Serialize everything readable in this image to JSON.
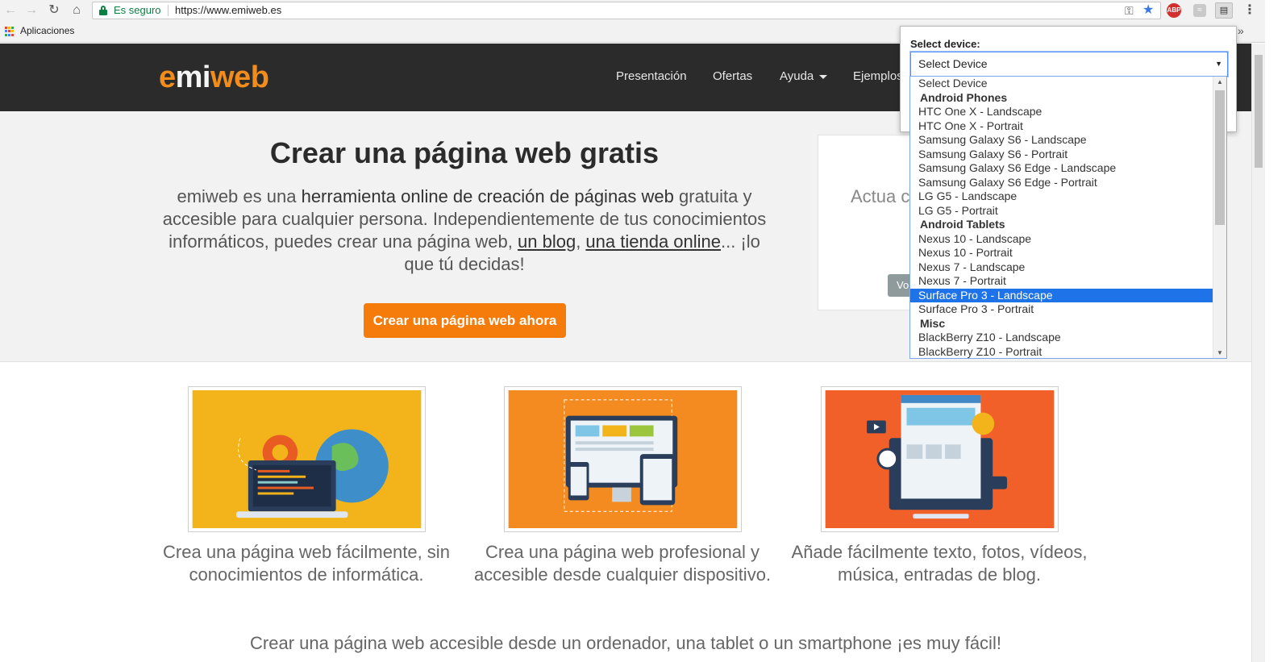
{
  "browser": {
    "secure_label": "Es seguro",
    "url": "https://www.emiweb.es",
    "bookmarks_apps": "Aplicaciones",
    "more_bookmarks": "»",
    "abp_label": "ABP"
  },
  "site": {
    "logo_parts": [
      "e",
      "mi",
      "web"
    ],
    "nav": [
      "Presentación",
      "Ofertas",
      "Ayuda",
      "Ejemplos"
    ],
    "hero_title": "Crear una página web gratis",
    "hero_desc": {
      "part1": "emiweb es una ",
      "bold": "herramienta online de creación de páginas web",
      "part2": " gratuita y accesible para cualquier persona. Independientemente de tus conocimientos informáticos, puedes crear una página web, ",
      "link1": "un blog",
      "sep": ", ",
      "link2": "una tienda online",
      "part3": "... ¡lo que tú decidas!"
    },
    "cta_label": "Crear una página web ahora",
    "side_card_text": "Actua conecta e",
    "side_card_button": "Vo",
    "features": [
      "Crea una página web fácilmente, sin conocimientos de informática.",
      "Crea una página web profesional y accesible desde cualquier dispositivo.",
      "Añade fácilmente texto, fotos, vídeos, música, entradas de blog."
    ],
    "bottom_line": "Crear una página web accesible desde un ordenador, una tablet o un smartphone ¡es muy fácil!"
  },
  "popup": {
    "label": "Select device:",
    "selected_value": "Select Device",
    "options": [
      {
        "text": "Select Device",
        "type": "option"
      },
      {
        "text": "Android Phones",
        "type": "group"
      },
      {
        "text": "HTC One X - Landscape",
        "type": "option"
      },
      {
        "text": "HTC One X - Portrait",
        "type": "option"
      },
      {
        "text": "Samsung Galaxy S6 - Landscape",
        "type": "option"
      },
      {
        "text": "Samsung Galaxy S6 - Portrait",
        "type": "option"
      },
      {
        "text": "Samsung Galaxy S6 Edge - Landscape",
        "type": "option"
      },
      {
        "text": "Samsung Galaxy S6 Edge - Portrait",
        "type": "option"
      },
      {
        "text": "LG G5 - Landscape",
        "type": "option"
      },
      {
        "text": "LG G5 - Portrait",
        "type": "option"
      },
      {
        "text": "Android Tablets",
        "type": "group"
      },
      {
        "text": "Nexus 10 - Landscape",
        "type": "option"
      },
      {
        "text": "Nexus 10 - Portrait",
        "type": "option"
      },
      {
        "text": "Nexus 7 - Landscape",
        "type": "option"
      },
      {
        "text": "Nexus 7 - Portrait",
        "type": "option"
      },
      {
        "text": "Surface Pro 3 - Landscape",
        "type": "option",
        "highlighted": true
      },
      {
        "text": "Surface Pro 3 - Portrait",
        "type": "option"
      },
      {
        "text": "Misc",
        "type": "group"
      },
      {
        "text": "BlackBerry Z10 - Landscape",
        "type": "option"
      },
      {
        "text": "BlackBerry Z10 - Portrait",
        "type": "option"
      }
    ]
  },
  "colors": {
    "brand_orange": "#f57c0a",
    "header_dark": "#2b2b2b",
    "secure_green": "#0b8043",
    "selection_blue": "#1e73e8"
  },
  "icons": [
    "back-icon",
    "forward-icon",
    "reload-icon",
    "home-icon",
    "lock-icon",
    "key-icon",
    "star-icon",
    "adblock-icon",
    "rss-icon",
    "device-emulator-icon",
    "menu-icon",
    "apps-icon"
  ]
}
